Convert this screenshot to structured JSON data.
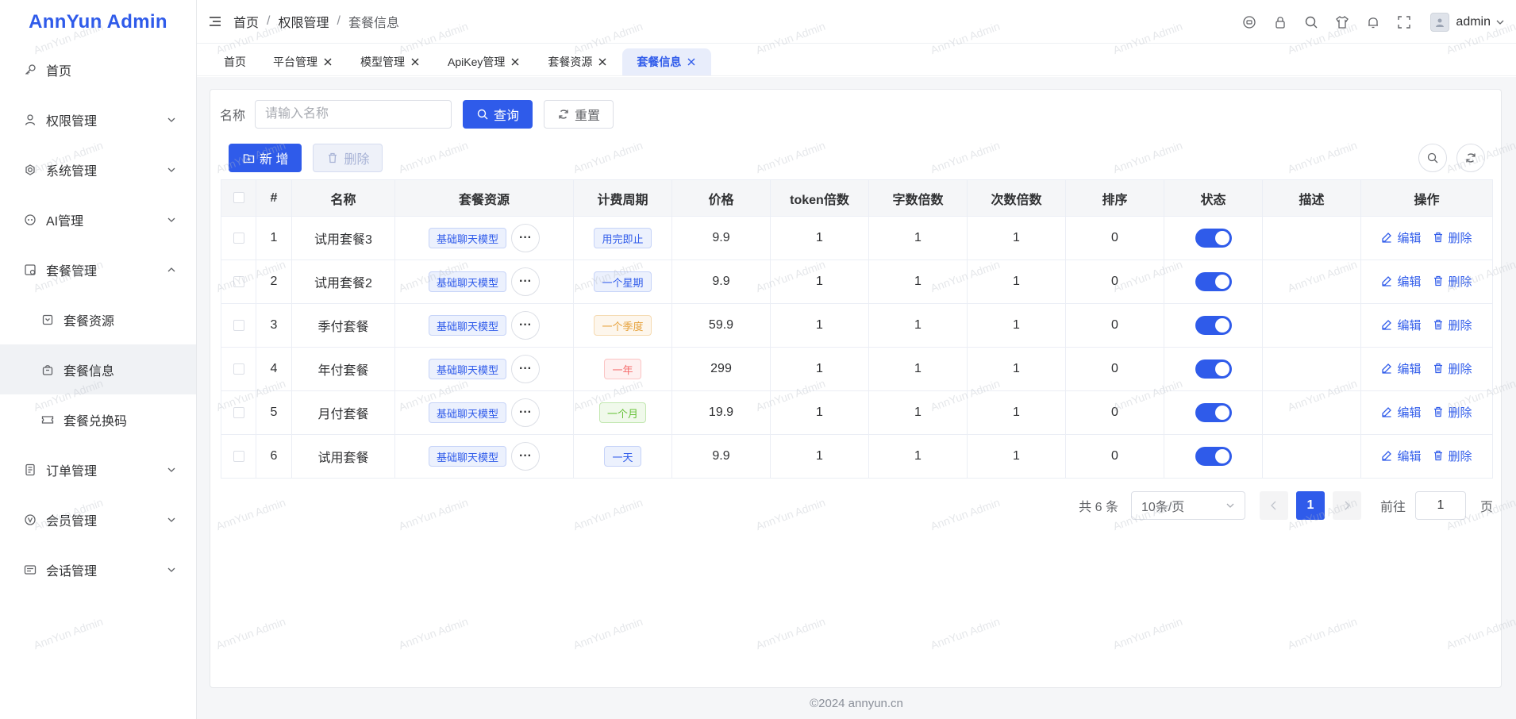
{
  "brand": "AnnYun Admin",
  "sidebar": {
    "items": [
      {
        "label": "首页",
        "icon": "key-icon"
      },
      {
        "label": "权限管理",
        "icon": "user-icon"
      },
      {
        "label": "系统管理",
        "icon": "settings-icon"
      },
      {
        "label": "AI管理",
        "icon": "ai-icon"
      },
      {
        "label": "套餐管理",
        "icon": "package-icon"
      },
      {
        "label": "套餐资源",
        "icon": "resource-icon"
      },
      {
        "label": "套餐信息",
        "icon": "bag-icon"
      },
      {
        "label": "套餐兑换码",
        "icon": "ticket-icon"
      },
      {
        "label": "订单管理",
        "icon": "order-icon"
      },
      {
        "label": "会员管理",
        "icon": "vip-icon"
      },
      {
        "label": "会话管理",
        "icon": "chat-icon"
      }
    ]
  },
  "header": {
    "breadcrumb": [
      "首页",
      "权限管理",
      "套餐信息"
    ],
    "breadcrumb_sep": "/",
    "user": "admin"
  },
  "tabs": [
    {
      "label": "首页",
      "closable": false
    },
    {
      "label": "平台管理",
      "closable": true
    },
    {
      "label": "模型管理",
      "closable": true
    },
    {
      "label": "ApiKey管理",
      "closable": true
    },
    {
      "label": "套餐资源",
      "closable": true
    },
    {
      "label": "套餐信息",
      "closable": true,
      "active": true
    }
  ],
  "search": {
    "label": "名称",
    "placeholder": "请输入名称",
    "query_btn": "查询",
    "reset_btn": "重置"
  },
  "toolbar": {
    "add_btn": "新 增",
    "delete_btn": "删除"
  },
  "table": {
    "headers": [
      "#",
      "名称",
      "套餐资源",
      "计费周期",
      "价格",
      "token倍数",
      "字数倍数",
      "次数倍数",
      "排序",
      "状态",
      "描述",
      "操作"
    ],
    "rows": [
      {
        "index": "1",
        "name": "试用套餐3",
        "resource": "基础聊天模型",
        "period": "用完即止",
        "period_color": "blue",
        "price": "9.9",
        "token": "1",
        "chars": "1",
        "times": "1",
        "sort": "0",
        "status": true,
        "desc": ""
      },
      {
        "index": "2",
        "name": "试用套餐2",
        "resource": "基础聊天模型",
        "period": "一个星期",
        "period_color": "blue",
        "price": "9.9",
        "token": "1",
        "chars": "1",
        "times": "1",
        "sort": "0",
        "status": true,
        "desc": ""
      },
      {
        "index": "3",
        "name": "季付套餐",
        "resource": "基础聊天模型",
        "period": "一个季度",
        "period_color": "orange",
        "price": "59.9",
        "token": "1",
        "chars": "1",
        "times": "1",
        "sort": "0",
        "status": true,
        "desc": ""
      },
      {
        "index": "4",
        "name": "年付套餐",
        "resource": "基础聊天模型",
        "period": "一年",
        "period_color": "red",
        "price": "299",
        "token": "1",
        "chars": "1",
        "times": "1",
        "sort": "0",
        "status": true,
        "desc": ""
      },
      {
        "index": "5",
        "name": "月付套餐",
        "resource": "基础聊天模型",
        "period": "一个月",
        "period_color": "green",
        "price": "19.9",
        "token": "1",
        "chars": "1",
        "times": "1",
        "sort": "0",
        "status": true,
        "desc": ""
      },
      {
        "index": "6",
        "name": "试用套餐",
        "resource": "基础聊天模型",
        "period": "一天",
        "period_color": "blue",
        "price": "9.9",
        "token": "1",
        "chars": "1",
        "times": "1",
        "sort": "0",
        "status": true,
        "desc": ""
      }
    ],
    "edit_label": "编辑",
    "delete_label": "删除"
  },
  "pagination": {
    "total": "共 6 条",
    "page_size": "10条/页",
    "current": "1",
    "goto_label": "前往",
    "goto_value": "1",
    "page_suffix": "页"
  },
  "footer": "©2024 annyun.cn",
  "watermark": "AnnYun Admin",
  "colors": {
    "primary": "#2f5bea",
    "sidebar_active_bg": "#f0f2f5",
    "tab_active_bg": "#e8edfb"
  }
}
